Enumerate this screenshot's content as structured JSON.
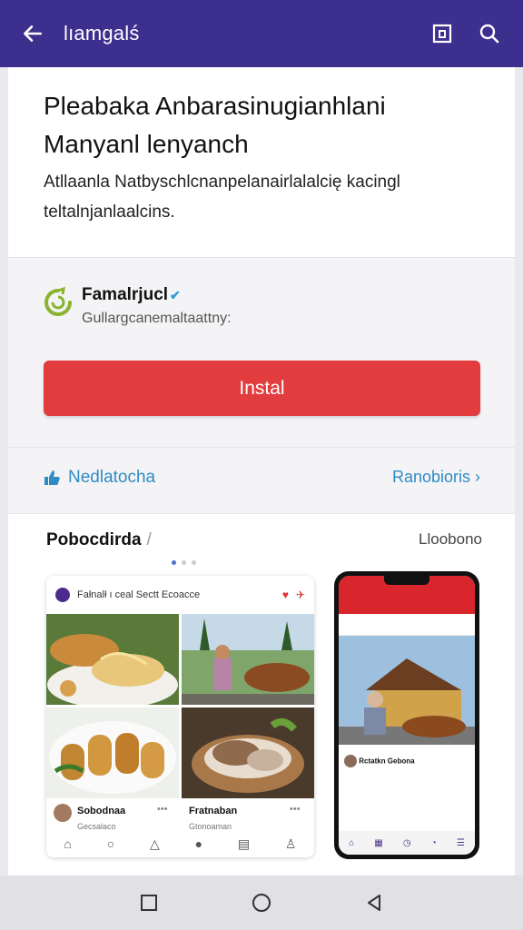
{
  "appbar": {
    "title": "lıamgalś",
    "back_icon": "arrow-left-icon",
    "bookmark_icon": "bookmark-square-icon",
    "search_icon": "search-icon"
  },
  "hero": {
    "title": "Pleabaka Anbarasinugianhlani Manyanl lenyanch",
    "description": "Atllaanla Natbyschlcnanpelanairlalalcię kacingl teltalnjanlaalcins."
  },
  "app": {
    "name": "Famalrjucl",
    "subtitle": "Gullargcanemaltaattny:",
    "install_label": "Instal",
    "accent": "#e23c3f"
  },
  "links": {
    "left_label": "Nedlatocha",
    "right_label": "Ranobioris ›"
  },
  "previews": {
    "heading": "Pobocdirda",
    "more_label": "Lloobono",
    "shot1": {
      "header_text": "Fałnalł  ı ceal Sectt  Ecoacce",
      "user1": "Sobodnaa",
      "user2": "Fratnaban",
      "footer1": "Gecsalaco",
      "footer2": "Gtonoaman"
    },
    "phone": {
      "user": "Rctatkn Gebona"
    }
  },
  "colors": {
    "appbar": "#3d2f8e",
    "link": "#2f8bc4"
  }
}
